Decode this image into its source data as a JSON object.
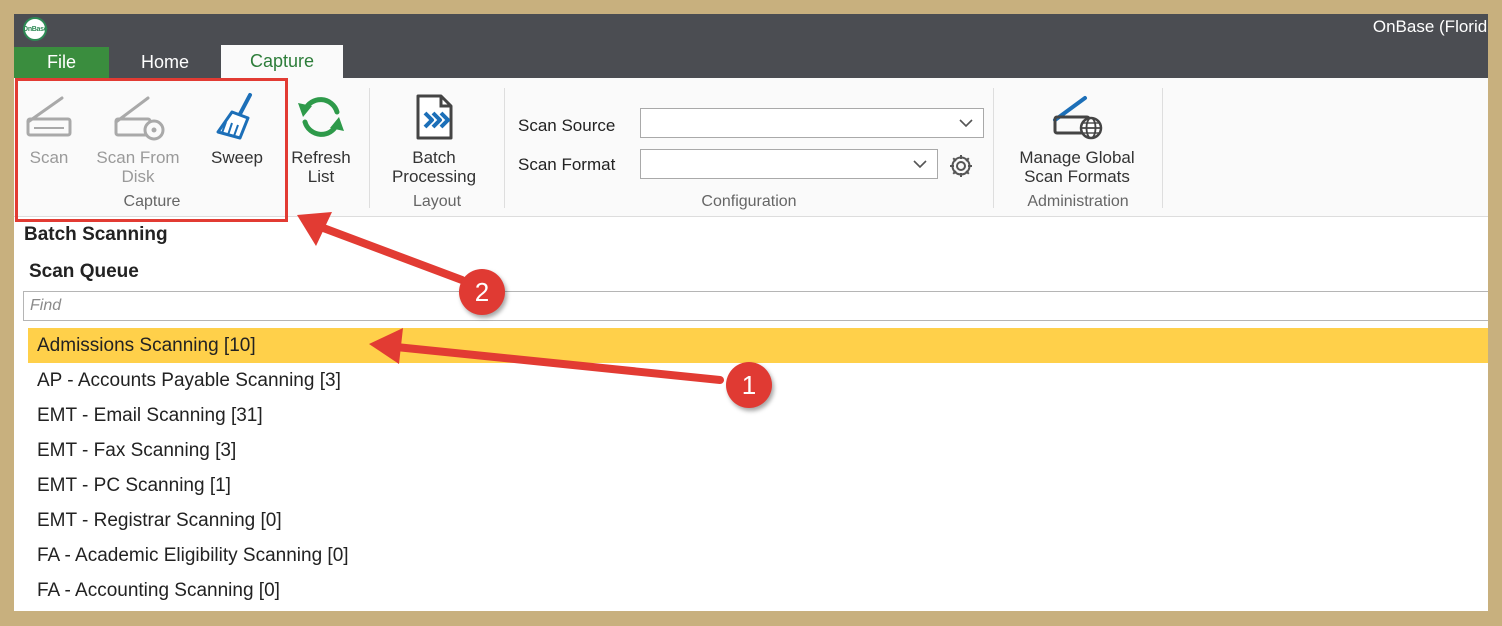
{
  "window": {
    "title": "OnBase (FloridaS"
  },
  "tabs": [
    {
      "label": "File"
    },
    {
      "label": "Home"
    },
    {
      "label": "Capture"
    }
  ],
  "ribbon": {
    "capture_group": {
      "label": "Capture",
      "scan": "Scan",
      "scan_from_disk_1": "Scan From",
      "scan_from_disk_2": "Disk",
      "sweep": "Sweep"
    },
    "refresh_1": "Refresh",
    "refresh_2": "List",
    "layout_group": {
      "label": "Layout",
      "batch_1": "Batch",
      "batch_2": "Processing"
    },
    "configuration_group": {
      "label": "Configuration",
      "scan_source_label": "Scan Source",
      "scan_source_value": "",
      "scan_format_label": "Scan Format",
      "scan_format_value": ""
    },
    "administration_group": {
      "label": "Administration",
      "manage_1": "Manage Global",
      "manage_2": "Scan Formats"
    }
  },
  "content": {
    "batch_scanning_title": "Batch Scanning",
    "scan_queue_title": "Scan Queue",
    "find_placeholder": "Find",
    "queues": [
      "Admissions Scanning [10]",
      "AP - Accounts Payable Scanning [3]",
      "EMT - Email Scanning [31]",
      "EMT - Fax Scanning [3]",
      "EMT - PC Scanning [1]",
      "EMT - Registrar Scanning [0]",
      "FA - Academic Eligibility Scanning [0]",
      "FA - Accounting Scanning [0]"
    ]
  },
  "annotations": {
    "badge_1": "1",
    "badge_2": "2"
  },
  "colors": {
    "titlebar": "#4b4d52",
    "file_tab": "#3a8d3e",
    "selected_row": "#ffd04a",
    "annotation": "#e23b33"
  }
}
